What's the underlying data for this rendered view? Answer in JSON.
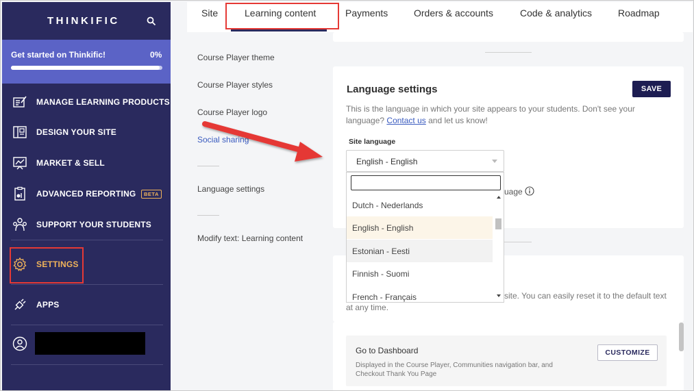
{
  "sidebar": {
    "logo": "THINKIFIC",
    "progress": {
      "label": "Get started on Thinkific!",
      "percent_text": "0%",
      "fraction": 0.98
    },
    "items": [
      {
        "label": "MANAGE LEARNING PRODUCTS",
        "icon": "edit-list-icon"
      },
      {
        "label": "DESIGN YOUR SITE",
        "icon": "layout-icon"
      },
      {
        "label": "MARKET & SELL",
        "icon": "chart-board-icon"
      },
      {
        "label": "ADVANCED REPORTING",
        "icon": "report-icon",
        "badge": "BETA"
      },
      {
        "label": "SUPPORT YOUR STUDENTS",
        "icon": "students-icon"
      },
      {
        "label": "SETTINGS",
        "icon": "gear-icon",
        "active": true
      },
      {
        "label": "APPS",
        "icon": "plug-icon"
      }
    ]
  },
  "tabs": [
    "Site",
    "Learning content",
    "Payments",
    "Orders & accounts",
    "Code & analytics",
    "Roadmap"
  ],
  "subnav": [
    "Course Player theme",
    "Course Player styles",
    "Course Player logo",
    "Social sharing",
    "Language settings",
    "Modify text: Learning content"
  ],
  "language": {
    "title": "Language settings",
    "save": "SAVE",
    "desc_1": "This is the language in which your site appears to your students. Don't see your language?",
    "contact": "Contact us",
    "desc_2": "and let us know!",
    "site_label": "Site language",
    "selected": "English - English",
    "options": [
      "Dutch - Nederlands",
      "English - English",
      "Estonian - Eesti",
      "Finnish - Suomi",
      "French - Français"
    ],
    "hidden_fragment": "uage"
  },
  "modify": {
    "fragment_1": "site. You can easily reset it to the default text",
    "fragment_2": "at any time."
  },
  "dashboard": {
    "title": "Go to Dashboard",
    "desc": "Displayed in the Course Player, Communities navigation bar, and Checkout Thank You Page",
    "button": "CUSTOMIZE"
  },
  "colors": {
    "sidebar": "#2a2a5e",
    "progress": "#5b63c6",
    "accent_settings": "#f0b35a",
    "annotation": "#e53935"
  }
}
